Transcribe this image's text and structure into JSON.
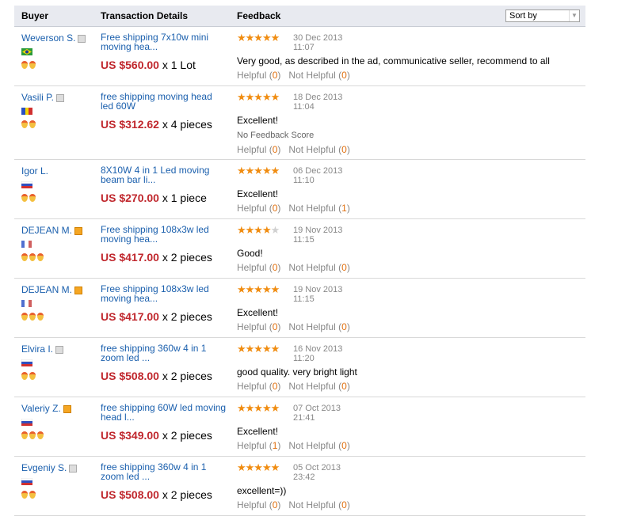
{
  "header": {
    "buyer": "Buyer",
    "transaction": "Transaction Details",
    "feedback": "Feedback",
    "sort_by": "Sort by"
  },
  "labels": {
    "helpful": "Helpful",
    "not_helpful": "Not Helpful"
  },
  "rows": [
    {
      "buyer": "Weverson S.",
      "icon": "grey",
      "flag": "brazil",
      "medals": 2,
      "product": "Free shipping 7x10w mini moving hea...",
      "price": "US $560.00",
      "qty": " x 1 Lot",
      "stars": 5,
      "date": "30 Dec 2013",
      "time": "11:07",
      "text": "Very good, as described in the ad, communicative seller, recommend to all",
      "helpful": "0",
      "not_helpful": "0"
    },
    {
      "buyer": "Vasili P.",
      "icon": "grey",
      "flag": "moldova",
      "medals": 2,
      "product": "free shipping moving head led 60W",
      "price": "US $312.62",
      "qty": " x 4 pieces",
      "stars": 5,
      "date": "18 Dec 2013",
      "time": "11:04",
      "text": "Excellent!",
      "note": "No Feedback Score",
      "helpful": "0",
      "not_helpful": "0"
    },
    {
      "buyer": "Igor L.",
      "icon": "none",
      "flag": "russia",
      "medals": 2,
      "product": "8X10W 4 in 1 Led moving beam bar li...",
      "price": "US $270.00",
      "qty": " x 1 piece",
      "stars": 5,
      "date": "06 Dec 2013",
      "time": "11:10",
      "text": "Excellent!",
      "helpful": "0",
      "not_helpful": "1"
    },
    {
      "buyer": "DEJEAN M.",
      "icon": "orange",
      "flag": "france",
      "medals": 3,
      "product": "Free shipping 108x3w led moving hea...",
      "price": "US $417.00",
      "qty": " x 2 pieces",
      "stars": 4,
      "date": "19 Nov 2013",
      "time": "11:15",
      "text": "Good!",
      "helpful": "0",
      "not_helpful": "0"
    },
    {
      "buyer": "DEJEAN M.",
      "icon": "orange",
      "flag": "france",
      "medals": 3,
      "product": "Free shipping 108x3w led moving hea...",
      "price": "US $417.00",
      "qty": " x 2 pieces",
      "stars": 5,
      "date": "19 Nov 2013",
      "time": "11:15",
      "text": "Excellent!",
      "helpful": "0",
      "not_helpful": "0"
    },
    {
      "buyer": "Elvira I.",
      "icon": "grey",
      "flag": "russia",
      "medals": 2,
      "product": "free shipping 360w 4 in 1 zoom led ...",
      "price": "US $508.00",
      "qty": " x 2 pieces",
      "stars": 5,
      "date": "16 Nov 2013",
      "time": "11:20",
      "text": "good quality. very bright light",
      "helpful": "0",
      "not_helpful": "0"
    },
    {
      "buyer": "Valeriy Z.",
      "icon": "orange",
      "flag": "russia",
      "medals": 3,
      "product": "free shipping 60W led moving head l...",
      "price": "US $349.00",
      "qty": " x 2 pieces",
      "stars": 5,
      "date": "07 Oct 2013",
      "time": "21:41",
      "text": "Excellent!",
      "helpful": "1",
      "not_helpful": "0"
    },
    {
      "buyer": "Evgeniy S.",
      "icon": "grey",
      "flag": "russia",
      "medals": 2,
      "product": "free shipping 360w 4 in 1 zoom led ...",
      "price": "US $508.00",
      "qty": " x 2 pieces",
      "stars": 5,
      "date": "05 Oct 2013",
      "time": "23:42",
      "text": "excellent=))",
      "helpful": "0",
      "not_helpful": "0"
    }
  ]
}
